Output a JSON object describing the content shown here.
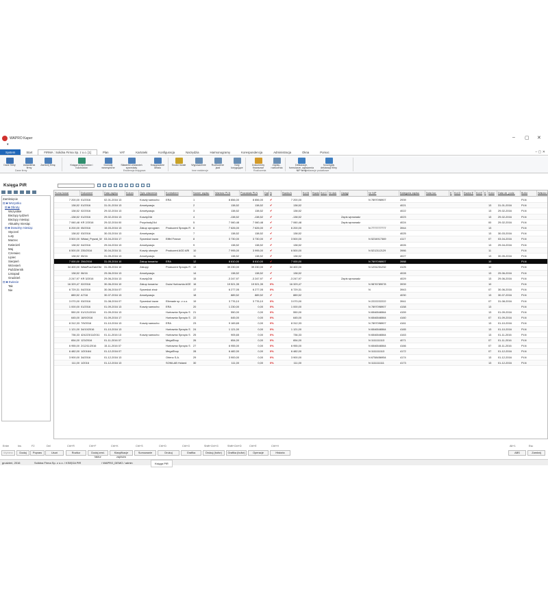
{
  "app": {
    "title": "WAPRO Kaper"
  },
  "tabs": [
    "System",
    "Start",
    "FIRMA : Solidna Firma Sp. z o.o. [1]",
    "Plan",
    "VAT",
    "Kartoteki",
    "Konfiguracja",
    "Narzędzia",
    "Harmonogramy",
    "Korespondencja",
    "Administracja",
    "Okna",
    "Pomoc"
  ],
  "ribbon": {
    "buttons": [
      "Dane firmy",
      "Ustawienia firmy",
      "Zamknij firmę",
      "Księga przychodów i rozchodów",
      "Dowody wewnętrzne",
      "Składniki zestawień sprzedaży",
      "Księgowanie detalu",
      "Środki trwałe",
      "Wyposażenie",
      "Rozliczenie jazd",
      "Noty korygujące",
      "Dokumenty finansowe",
      "Zapisy - rozliczenia",
      "Deklaracje, formularze, zgłoszenia NIP firmy",
      "Szczegóły deklaracji firmy"
    ],
    "groups": [
      "Dane firmy",
      "Ewidencja księgowa",
      "Inne ewidencje",
      "Rozliczenia",
      "Deklaracje podatkowe"
    ]
  },
  "page_title": "Księga PiR",
  "tree": [
    {
      "label": "Zamknięcie",
      "dir": false
    },
    {
      "label": "⊟ ■ Wszystko",
      "dir": true
    },
    {
      "label": "⊟ ■ Obroty",
      "dir": true
    },
    {
      "label": "Wszystkie",
      "dir": false
    },
    {
      "label": "Bieżący tydzień",
      "dir": false
    },
    {
      "label": "Bieżący miesiąc",
      "dir": false
    },
    {
      "label": "Aktualny miesiąc",
      "dir": false
    },
    {
      "label": "⊟ ■ Dowolny miesiąc",
      "dir": true
    },
    {
      "label": "Styczeń",
      "dir": false
    },
    {
      "label": "Luty",
      "dir": false
    },
    {
      "label": "Marzec",
      "dir": false
    },
    {
      "label": "Kwiecień",
      "dir": false
    },
    {
      "label": "Maj",
      "dir": false
    },
    {
      "label": "Czerwiec",
      "dir": false
    },
    {
      "label": "Lipiec",
      "dir": false
    },
    {
      "label": "Sierpień",
      "dir": false
    },
    {
      "label": "Wrzesień",
      "dir": false
    },
    {
      "label": "Październik",
      "dir": false
    },
    {
      "label": "Listopad",
      "dir": false
    },
    {
      "label": "Grudzień",
      "dir": false
    },
    {
      "label": "⊟ ■ Kwiecie",
      "dir": true
    },
    {
      "label": "Tak",
      "dir": false
    },
    {
      "label": "Nie",
      "dir": false
    }
  ],
  "columns": [
    "Suma towar",
    "Dokument",
    "Data zapisu",
    "Kolum",
    "Opis zdarzenia",
    "Kontrahent",
    "Numer zapisu",
    "Wartość PLN",
    "Pozostało PLN",
    "Dat",
    "N",
    "Kwota A",
    "Kol.B",
    "Kwota",
    "Kol.C",
    "Nr dok",
    "Uwagi",
    "Nr NIP",
    "Kategoria zapisu",
    "Nota kor.",
    "K",
    "Kol.D",
    "Kwota E",
    "Kol.E",
    "K",
    "Kolor",
    "Data ob. podz.",
    "Bufor",
    "Waluta dokum"
  ],
  "rows": [
    {
      "suma": "7 200,00",
      "dok": "01/2016",
      "data": "02-01-2016 13",
      "opis": "Koszty samocho",
      "kontr": "ERA",
      "nr": "1",
      "wart": "8 856,00",
      "poz": "8 856,00",
      "chk": "✔",
      "kwota": "7 200,00",
      "nip": "N 7897098907",
      "kat": "2939",
      "uwagi": "",
      "kolor": "",
      "dob": "",
      "bufor": "PLN"
    },
    {
      "suma": "138,52",
      "dok": "01/2016",
      "data": "31-01-2016 13",
      "opis": "Amortyzacja",
      "kontr": "",
      "nr": "2",
      "wart": "138,52",
      "poz": "138,52",
      "chk": "✔",
      "kwota": "138,52",
      "nip": "",
      "kat": "4021",
      "uwagi": "",
      "kolor": "13",
      "dob": "31-01-2016",
      "bufor": "PLN"
    },
    {
      "suma": "138,52",
      "dok": "02/2016",
      "data": "29-02-2016 13",
      "opis": "Amortyzacja",
      "kontr": "",
      "nr": "3",
      "wart": "138,52",
      "poz": "138,52",
      "chk": "✔",
      "kwota": "138,52",
      "nip": "",
      "kat": "4022",
      "uwagi": "",
      "kolor": "13",
      "dob": "29-02-2016",
      "bufor": "PLN"
    },
    {
      "suma": "-138,52",
      "dok": "01/2016",
      "data": "29-02-2016 13",
      "opis": "Koszty24d",
      "kontr": "",
      "nr": "4",
      "wart": "-138,52",
      "poz": "-138,52",
      "chk": "✔",
      "kwota": "-138,52",
      "nip": "",
      "kat": "4023",
      "uwagi": "Zapis wprowadz",
      "kolor": "13",
      "dob": "29-02-2016",
      "bufor": "PLN"
    },
    {
      "suma": "7 060,48",
      "dok": "KR 2/2016",
      "data": "29-02-2016 00",
      "opis": "Przychody24d",
      "kontr": "",
      "nr": "5",
      "wart": "7 060,48",
      "poz": "7 060,48",
      "chk": "✔",
      "kwota": "7 060,48",
      "nip": "",
      "kat": "4024",
      "uwagi": "Zapis wprowadz",
      "kolor": "00",
      "dob": "29-02-2016",
      "bufor": "PLN"
    },
    {
      "suma": "6 200,00",
      "dok": "05/2016",
      "data": "15-03-2016 13",
      "opis": "Zakup oprogram",
      "kontr": "Producent Sprzętu R",
      "nr": "6",
      "wart": "7 626,00",
      "poz": "7 626,00",
      "chk": "✔",
      "kwota": "6 200,00",
      "nip": "N 7777777777",
      "kat": "3944",
      "uwagi": "",
      "kolor": "13",
      "dob": "",
      "bufor": "PLN"
    },
    {
      "suma": "138,52",
      "dok": "03/2016",
      "data": "30-03-2016 13",
      "opis": "Amortyzacja",
      "kontr": "",
      "nr": "7",
      "wart": "138,52",
      "poz": "138,52",
      "chk": "✔",
      "kwota": "138,52",
      "nip": "",
      "kat": "4025",
      "uwagi": "",
      "kolor": "13",
      "dob": "30-03-2016",
      "bufor": "PLN"
    },
    {
      "suma": "3 500,00",
      "dok": "Wkład_Prywat_W",
      "data": "03-04-2016 17",
      "opis": "Sprzedaż towar",
      "kontr": "Eiffel France",
      "nr": "8",
      "wart": "3 730,00",
      "poz": "3 730,00",
      "chk": "✔",
      "kwota": "3 500,00",
      "nip": "N 5234917369",
      "kat": "4117",
      "uwagi": "",
      "kolor": "07",
      "dob": "03-04-2016",
      "bufor": "PLN"
    },
    {
      "suma": "138,52",
      "dok": "04/2016",
      "data": "29-04-2016 13",
      "opis": "Amortyzacja",
      "kontr": "",
      "nr": "9",
      "wart": "138,52",
      "poz": "138,52",
      "chk": "✔",
      "kwota": "138,52",
      "nip": "",
      "kat": "4026",
      "uwagi": "",
      "kolor": "13",
      "dob": "29-04-2016",
      "bufor": "PLN"
    },
    {
      "suma": "6 500,00",
      "dok": "235/2016",
      "data": "30-04-2016 11",
      "opis": "Koszty ubezpie",
      "kontr": "Producent AGD ARI",
      "nr": "10",
      "wart": "7 995,00",
      "poz": "3 995,00",
      "chk": "✔",
      "kwota": "6 500,00",
      "nip": "N 5212112129",
      "kat": "3986",
      "uwagi": "",
      "kolor": "11",
      "dob": "",
      "bufor": "PLN"
    },
    {
      "suma": "138,52",
      "dok": "05/16",
      "data": "31-05-2016 13",
      "opis": "Amortyzacja",
      "kontr": "",
      "nr": "11",
      "wart": "138,52",
      "poz": "138,52",
      "chk": "✔",
      "kwota": "138,52",
      "nip": "",
      "kat": "4027",
      "uwagi": "",
      "kolor": "13",
      "dob": "30-05-2016",
      "bufor": "PLN"
    },
    {
      "suma": "7 000,00",
      "dok": "256/2016",
      "data": "31-05-2016 10",
      "opis": "Zakup towarów",
      "kontr": "ERA",
      "nr": "12",
      "wart": "8 610,00",
      "poz": "8 610,00",
      "chk": "✔",
      "kwota": "7 000,00",
      "nip": "N 7897098907",
      "kat": "3988",
      "uwagi": "",
      "kolor": "10",
      "dob": "",
      "bufor": "PLN",
      "hl": true
    },
    {
      "suma": "34 400,00",
      "dok": "WłaśPoz/Zak/Obr",
      "data": "31-05-2016 10",
      "opis": "Zakupy",
      "kontr": "Producent Sprzętu R",
      "nr": "13",
      "wart": "39 230,00",
      "poz": "39 230,00",
      "chk": "✔",
      "kwota": "34 400,00",
      "nip": "N 1231231232",
      "kat": "4125",
      "uwagi": "",
      "kolor": "10",
      "dob": "",
      "bufor": "PLN"
    },
    {
      "suma": "138,52",
      "dok": "06/16",
      "data": "29-06-2016 13",
      "opis": "Amortyzacja",
      "kontr": "",
      "nr": "14",
      "wart": "138,52",
      "poz": "138,52",
      "chk": "✔",
      "kwota": "138,52",
      "nip": "",
      "kat": "4028",
      "uwagi": "",
      "kolor": "13",
      "dob": "29-06-2016",
      "bufor": "PLN"
    },
    {
      "suma": "-3 247,97",
      "dok": "KR 3/2016",
      "data": "29-06-2016 13",
      "opis": "Koszty24d",
      "kontr": "",
      "nr": "15",
      "wart": "-3 247,97",
      "poz": "-3 247,97",
      "chk": "✔",
      "kwota": "-3 247,97",
      "nip": "",
      "kat": "4029",
      "uwagi": "Zapis wprowadz",
      "kolor": "13",
      "dob": "29-06-2016",
      "bufor": "PLN"
    },
    {
      "suma": "16 329,47",
      "dok": "02/2016",
      "data": "30-06-2016 10",
      "opis": "Zakup towarów",
      "kontr": "Duża Hurtownia AGE",
      "nr": "16",
      "wart": "19 521,35",
      "poz": "19 521,35",
      "chk": "0%",
      "kwota": "16 329,47",
      "nip": "N 9876789078",
      "kat": "3939",
      "uwagi": "",
      "kolor": "10",
      "dob": "",
      "bufor": "PLN"
    },
    {
      "suma": "6 729,31",
      "dok": "04/2016",
      "data": "30-06-2016 07",
      "opis": "Sprzedaż zboż",
      "kontr": "",
      "nr": "17",
      "wart": "6 277,05",
      "poz": "6 277,05",
      "chk": "0%",
      "kwota": "6 729,31",
      "nip": "N",
      "kat": "3943",
      "uwagi": "",
      "kolor": "07",
      "dob": "30-06-2016",
      "bufor": "PLN"
    },
    {
      "suma": "889,52",
      "dok": "A7/16",
      "data": "30-07-2016 13",
      "opis": "Amortyzacja",
      "kontr": "",
      "nr": "18",
      "wart": "889,52",
      "poz": "889,52",
      "chk": "✔",
      "kwota": "889,52",
      "nip": "",
      "kat": "4030",
      "uwagi": "",
      "kolor": "13",
      "dob": "30-07-2016",
      "bufor": "PLN"
    },
    {
      "suma": "3 070,00",
      "dok": "03/2016",
      "data": "31-08-2016 07",
      "opis": "Sprzedaż towar",
      "kontr": "Elbmade sp. z o.o.",
      "nr": "19",
      "wart": "3 776,10",
      "poz": "3 776,10",
      "chk": "0%",
      "kwota": "3 070,00",
      "nip": "N 2222222222",
      "kat": "3941",
      "uwagi": "",
      "kolor": "07",
      "dob": "31-08-2016",
      "bufor": "PLN"
    },
    {
      "suma": "1 000,00",
      "dok": "01/2016",
      "data": "01-09-2016 13",
      "opis": "Koszty samocho",
      "kontr": "ERA",
      "nr": "20",
      "wart": "1 230,00",
      "poz": "0,00",
      "chk": "0%",
      "kwota": "1 000,00",
      "nip": "N 7897098907",
      "kat": "4158",
      "uwagi": "",
      "kolor": "13",
      "dob": "",
      "bufor": "PLN"
    },
    {
      "suma": "550,00",
      "dok": "01/121/2016",
      "data": "01-09-2016 13",
      "opis": "",
      "kontr": "Hurtownia Sprzętu S",
      "nr": "21",
      "wart": "550,00",
      "poz": "0,00",
      "chk": "0%",
      "kwota": "550,00",
      "nip": "N 6546546564",
      "kat": "4159",
      "uwagi": "",
      "kolor": "13",
      "dob": "01-09-2016",
      "bufor": "PLN"
    },
    {
      "suma": "645,00",
      "dok": "18/9/2016",
      "data": "01-09-2016 17",
      "opis": "",
      "kontr": "Hurtownia Sprzętu S",
      "nr": "22",
      "wart": "645,00",
      "poz": "0,00",
      "chk": "0%",
      "kwota": "645,00",
      "nip": "N 6546546564",
      "kat": "4160",
      "uwagi": "",
      "kolor": "07",
      "dob": "01-09-2016",
      "bufor": "PLN"
    },
    {
      "suma": "8 312,33",
      "dok": "7/9/2016",
      "data": "01-10-2016 13",
      "opis": "Koszty samocho",
      "kontr": "ERA",
      "nr": "23",
      "wart": "9 169,65",
      "poz": "0,00",
      "chk": "0%",
      "kwota": "8 312,33",
      "nip": "N 7897098907",
      "kat": "4161",
      "uwagi": "",
      "kolor": "13",
      "dob": "01-10-2016",
      "bufor": "PLN"
    },
    {
      "suma": "1 121,00",
      "dok": "34/10/2016",
      "data": "01-10-2016 13",
      "opis": "",
      "kontr": "Hurtownia Sprzętu S",
      "nr": "24",
      "wart": "1 121,00",
      "poz": "0,00",
      "chk": "0%",
      "kwota": "1 121,00",
      "nip": "N 6546546564",
      "kat": "4165",
      "uwagi": "",
      "kolor": "13",
      "dob": "01-10-2016",
      "bufor": "PLN"
    },
    {
      "suma": "736,33",
      "dok": "424223/11/2011",
      "data": "01-11-2016 13",
      "opis": "Koszty samocho",
      "kontr": "Hurtownia Sprzętu S",
      "nr": "25",
      "wart": "905,65",
      "poz": "0,00",
      "chk": "0%",
      "kwota": "736,33",
      "nip": "N 6546546564",
      "kat": "4163",
      "uwagi": "",
      "kolor": "13",
      "dob": "01-11-2016",
      "bufor": "PLN"
    },
    {
      "suma": "654,00",
      "dok": "123/2016",
      "data": "01-11-2016 07",
      "opis": "",
      "kontr": "MegaShop",
      "nr": "26",
      "wart": "654,00",
      "poz": "0,00",
      "chk": "0%",
      "kwota": "654,00",
      "nip": "N 1111111113",
      "kat": "4071",
      "uwagi": "",
      "kolor": "07",
      "dob": "01-11-2016",
      "bufor": "PLN"
    },
    {
      "suma": "6 955,00",
      "dok": "2/12/11/2016",
      "data": "15-11-2016 07",
      "opis": "",
      "kontr": "Hurtownia Sprzętu S",
      "nr": "27",
      "wart": "6 955,00",
      "poz": "0,00",
      "chk": "0%",
      "kwota": "6 955,00",
      "nip": "N 6546546564",
      "kat": "4166",
      "uwagi": "",
      "kolor": "07",
      "dob": "15-11-2016",
      "bufor": "PLN"
    },
    {
      "suma": "6 482,00",
      "dok": "1/2016/4",
      "data": "01-12-2016 07",
      "opis": "",
      "kontr": "MegaShop",
      "nr": "28",
      "wart": "6 482,00",
      "poz": "0,00",
      "chk": "0%",
      "kwota": "6 482,00",
      "nip": "N 1111111113",
      "kat": "4172",
      "uwagi": "",
      "kolor": "07",
      "dob": "01-12-2016",
      "bufor": "PLN"
    },
    {
      "suma": "3 900,00",
      "dok": "34/2016",
      "data": "01-12-2016 13",
      "opis": "",
      "kontr": "Orleno S.A.",
      "nr": "29",
      "wart": "3 900,00",
      "poz": "0,00",
      "chk": "0%",
      "kwota": "3 900,00",
      "nip": "N 6758456954",
      "kat": "4174",
      "uwagi": "",
      "kolor": "13",
      "dob": "01-12-2016",
      "bufor": "PLN"
    },
    {
      "suma": "111,00",
      "dok": "1/2016",
      "data": "01-12-2016 13",
      "opis": "",
      "kontr": "SONILAB Holand",
      "nr": "30",
      "wart": "111,00",
      "poz": "0,00",
      "chk": "0%",
      "kwota": "111,00",
      "nip": "N 1111111111",
      "kat": "4173",
      "uwagi": "",
      "kolor": "13",
      "dob": "01-12-2016",
      "bufor": "PLN"
    }
  ],
  "keys": [
    "Enter",
    "Ins",
    "F2",
    "Del",
    "Ctrl+R",
    "Ctrl+F",
    "Ctrl+K",
    "Ctrl+S",
    "Ctrl+D",
    "Ctrl+G",
    "Shift+Ctrl+G",
    "Shift+Ctrl+D",
    "Ctrl+E",
    "Ctrl+H",
    "Alt+1",
    "Esc"
  ],
  "buttons": [
    "Wybierz",
    "Dodaj",
    "Popraw",
    "Usuń",
    "Rozlicz",
    "Dodaj zest. faktur",
    "Klasyfikacje zapisów",
    "Sumowanie",
    "Drukuj",
    "Grafika",
    "Drukuj (bufor)",
    "Grafika (bufor)",
    "Operacje",
    "Historia",
    "ABS",
    "Zamknij"
  ],
  "status": {
    "period": "grudzień, 2016",
    "company": "Solidna Firma Sp. z o.o. / KSIĘGA PiR",
    "db": "/ WAPRO_DEMO / admin",
    "tab": "Księga PiR"
  }
}
